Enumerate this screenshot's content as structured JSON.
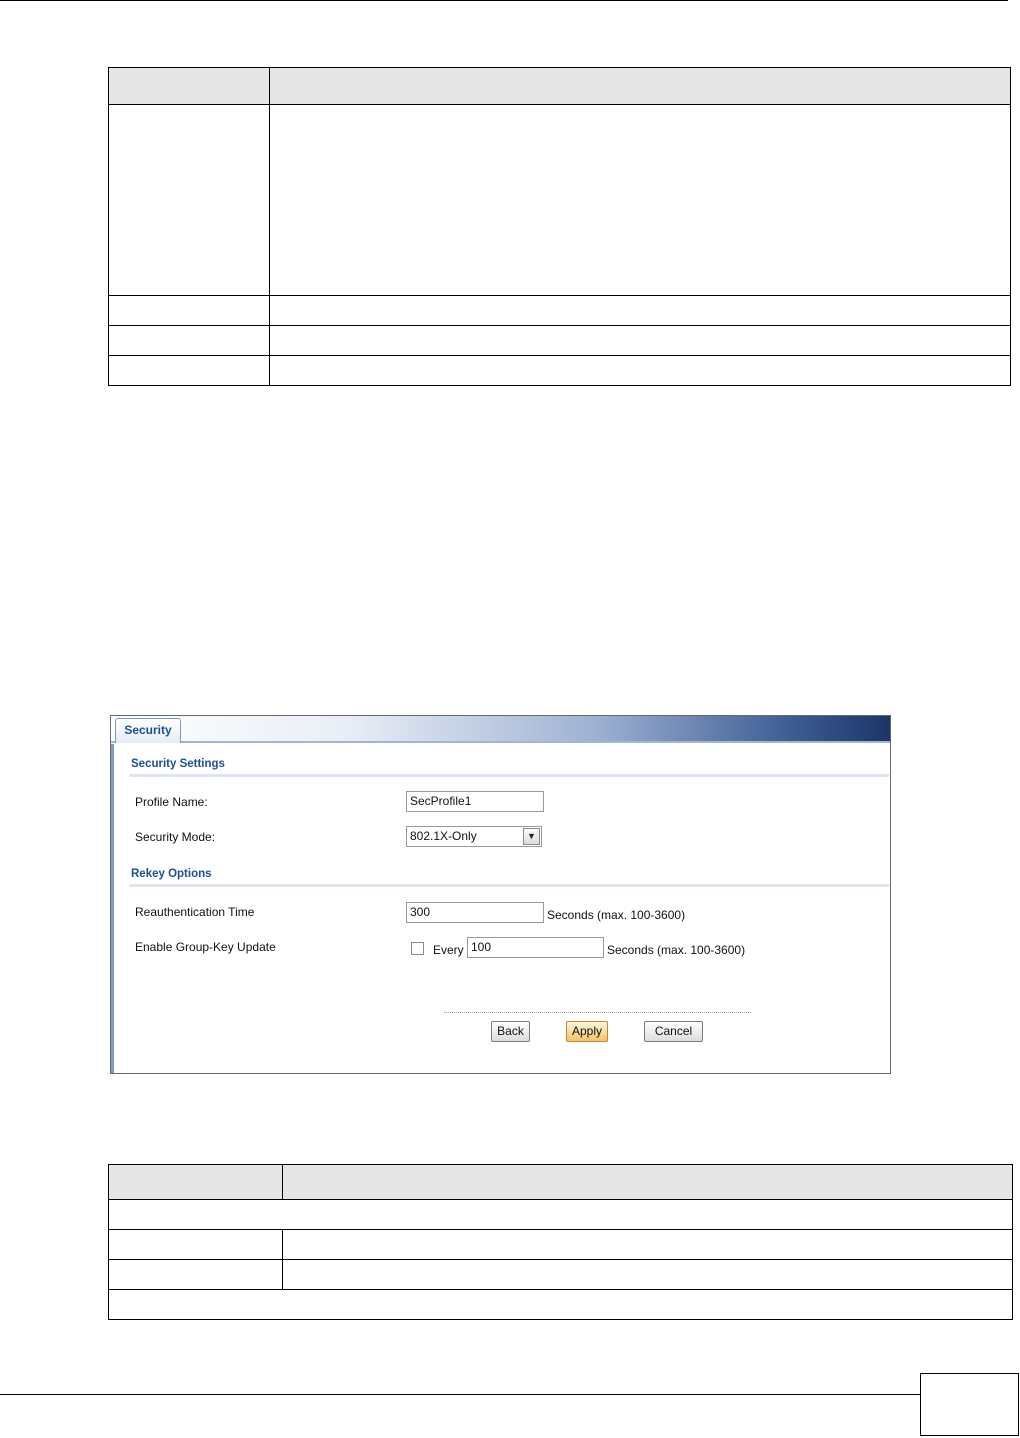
{
  "security_screen": {
    "tab_label": "Security",
    "sections": {
      "settings_title": "Security Settings",
      "rekey_title": "Rekey Options"
    },
    "profile_name": {
      "label": "Profile Name:",
      "value": "SecProfile1"
    },
    "security_mode": {
      "label": "Security Mode:",
      "value": "802.1X-Only"
    },
    "reauth_time": {
      "label": "Reauthentication Time",
      "value": "300",
      "unit": "Seconds (max. 100-3600)"
    },
    "group_key_update": {
      "label": "Enable Group-Key Update",
      "checked": false,
      "every_label": "Every",
      "value": "100",
      "unit": "Seconds (max. 100-3600)"
    },
    "buttons": {
      "back": "Back",
      "apply": "Apply",
      "cancel": "Cancel"
    }
  },
  "colors": {
    "section_title": "#1f4f8f",
    "table_header": "#e6e6e6",
    "apply_button": "#f4c26b"
  }
}
